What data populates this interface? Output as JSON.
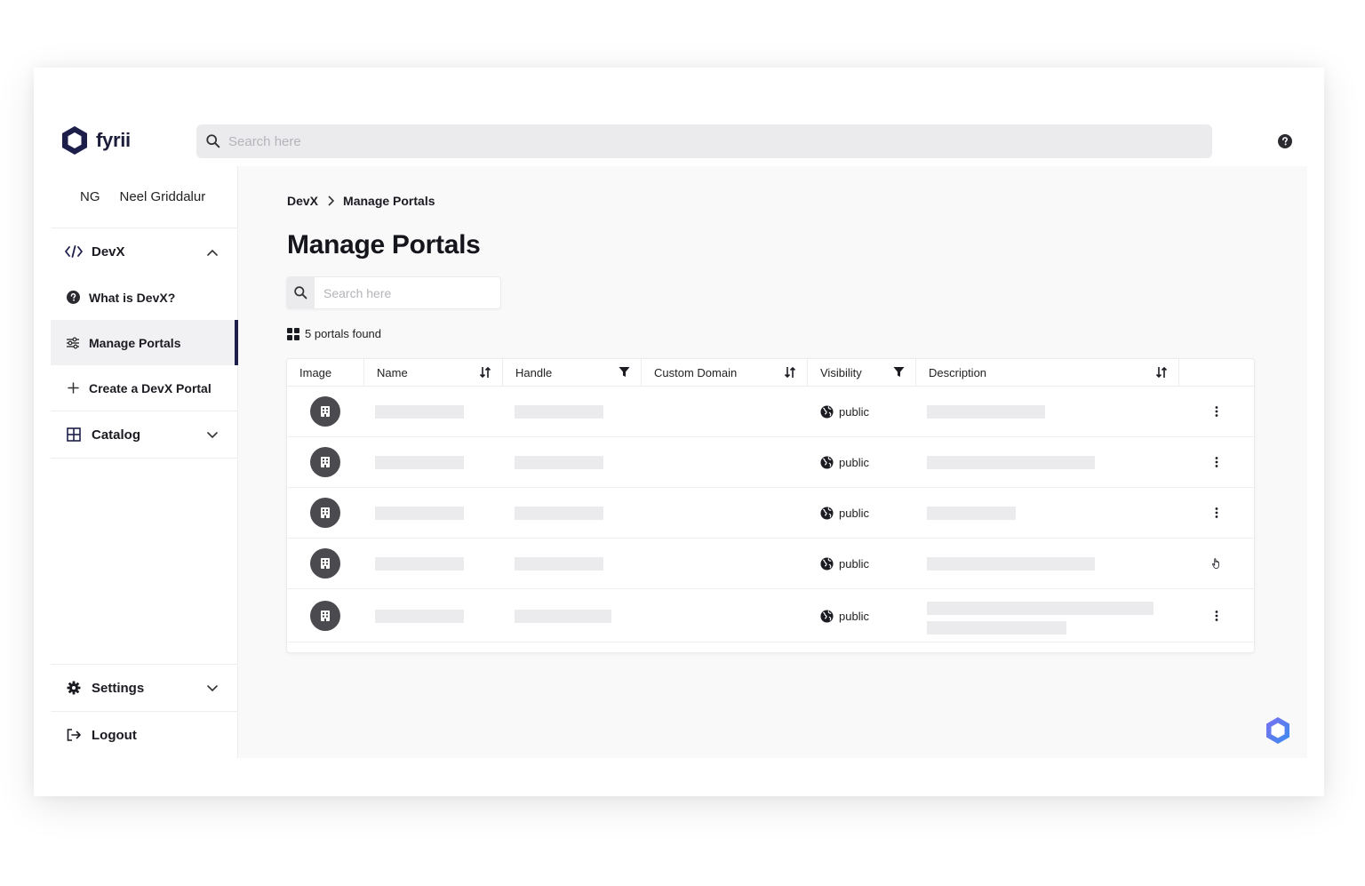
{
  "app": {
    "name": "fyrii"
  },
  "header": {
    "search_placeholder": "Search here",
    "help_icon": "question-circle-icon"
  },
  "user": {
    "initials": "NG",
    "name": "Neel Griddalur"
  },
  "sidebar": {
    "devx": {
      "label": "DevX",
      "icon": "code-icon",
      "expanded": true
    },
    "items": [
      {
        "label": "What is DevX?",
        "icon": "question-circle-icon",
        "active": false
      },
      {
        "label": "Manage Portals",
        "icon": "sliders-icon",
        "active": true
      },
      {
        "label": "Create a DevX Portal",
        "icon": "plus-icon",
        "active": false
      }
    ],
    "catalog": {
      "label": "Catalog",
      "icon": "grid-icon"
    },
    "settings": {
      "label": "Settings",
      "icon": "gear-icon"
    },
    "logout": {
      "label": "Logout",
      "icon": "logout-icon"
    }
  },
  "breadcrumb": {
    "parent": "DevX",
    "current": "Manage Portals"
  },
  "page": {
    "title": "Manage Portals",
    "search_placeholder": "Search here",
    "count_label": "5 portals found"
  },
  "table": {
    "columns": [
      {
        "label": "Image",
        "tool": ""
      },
      {
        "label": "Name",
        "tool": "sort-icon"
      },
      {
        "label": "Handle",
        "tool": "filter-icon"
      },
      {
        "label": "Custom Domain",
        "tool": "sort-icon"
      },
      {
        "label": "Visibility",
        "tool": "filter-icon"
      },
      {
        "label": "Description",
        "tool": "sort-icon"
      }
    ],
    "rows": [
      {
        "visibility": "public"
      },
      {
        "visibility": "public"
      },
      {
        "visibility": "public"
      },
      {
        "visibility": "public"
      },
      {
        "visibility": "public"
      }
    ]
  },
  "colors": {
    "brand": "#1d1f4a",
    "accent_fab": "#4a5ae8",
    "placeholder": "#ebebed"
  }
}
